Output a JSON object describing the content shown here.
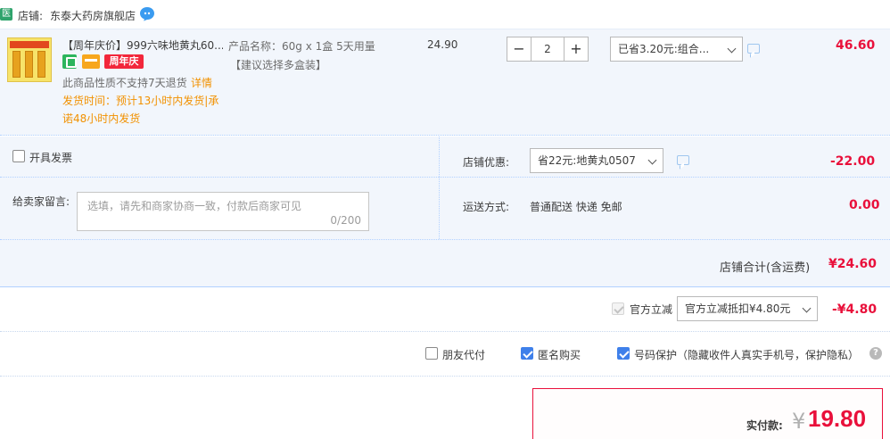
{
  "shop": {
    "badge": "医",
    "label": "店铺:",
    "name": "东泰大药房旗舰店"
  },
  "item": {
    "thumb_text": "999六味地黄丸",
    "title": "【周年庆价】999六味地黄丸60...",
    "promo_tag": "周年庆",
    "return_note": "此商品性质不支持7天退货",
    "detail_link": "详情",
    "shipping_line1": "发货时间：预计13小时内发货|承",
    "shipping_line2": "诺48小时内发货",
    "spec": "产品名称：60g x 1盒 5天用量",
    "spec_note": "【建议选择多盒装】",
    "unit_price": "24.90",
    "qty_minus": "−",
    "qty_value": "2",
    "qty_plus": "+",
    "discount_select": "已省3.20元:组合...",
    "subtotal": "46.60"
  },
  "options": {
    "invoice_label": "开具发票",
    "message_label": "给卖家留言:",
    "message_placeholder": "选填，请先和商家协商一致，付款后商家可见",
    "message_count": "0/200",
    "shop_discount_label": "店铺优惠:",
    "shop_discount_select": "省22元:地黄丸0507",
    "shop_discount_amount": "-22.00",
    "shipping_label": "运送方式:",
    "shipping_value": "普通配送 快递 免邮",
    "shipping_amount": "0.00"
  },
  "shop_total": {
    "label": "店铺合计(含运费)",
    "amount": "¥24.60"
  },
  "platform": {
    "label": "官方立减",
    "select": "官方立减抵扣¥4.80元",
    "amount": "-¥4.80"
  },
  "extras": {
    "friend_pay": "朋友代付",
    "anonymous": "匿名购买",
    "number_protect": "号码保护（隐藏收件人真实手机号，保护隐私）",
    "help": "?"
  },
  "payment": {
    "label": "实付款:",
    "currency": "¥",
    "amount": "19.80"
  },
  "colors": {
    "price_red": "#e9103b",
    "accent_blue": "#3f80ea",
    "panel_bg": "#f2f6fc",
    "notice_orange": "#f29100"
  }
}
